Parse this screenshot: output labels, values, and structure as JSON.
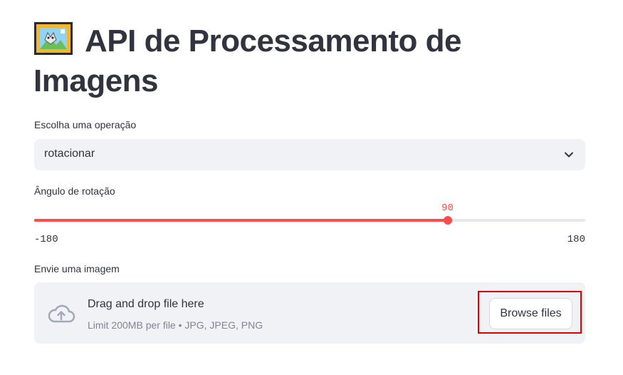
{
  "header": {
    "title_icon": "framed-picture-icon",
    "title": "API de Processamento de Imagens"
  },
  "operation": {
    "label": "Escolha uma operação",
    "selected": "rotacionar",
    "icon": "chevron-down-icon"
  },
  "rotation": {
    "label": "Ângulo de rotação",
    "value": 90,
    "value_text": "90",
    "min": -180,
    "max": 180,
    "min_text": "-180",
    "max_text": "180",
    "accent_color": "#ff4b4b"
  },
  "upload": {
    "label": "Envie uma imagem",
    "icon": "cloud-upload-icon",
    "drop_title": "Drag and drop file here",
    "drop_limit": "Limit 200MB per file • JPG, JPEG, PNG",
    "browse_label": "Browse files",
    "highlight_color": "#e00000"
  }
}
